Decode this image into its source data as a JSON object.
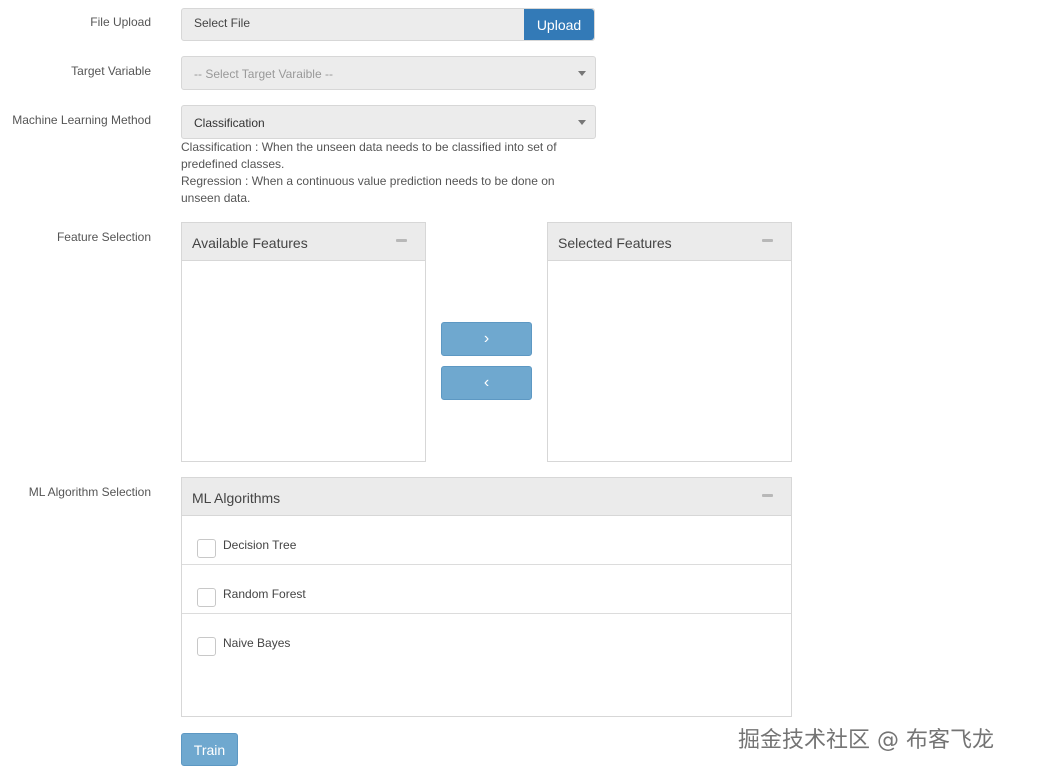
{
  "form": {
    "file_upload_label": "File Upload",
    "file_placeholder": "Select File",
    "upload_button": "Upload",
    "target_variable_label": "Target Variable",
    "target_variable_value": "-- Select Target Varaible --",
    "ml_method_label": "Machine Learning Method",
    "ml_method_value": "Classification",
    "help_classification": "Classification : When the unseen data needs to be classified into set of predefined classes.",
    "help_regression": "Regression : When a continuous value prediction needs to be done on unseen data.",
    "feature_selection_label": "Feature Selection",
    "available_features_title": "Available Features",
    "selected_features_title": "Selected Features",
    "move_right_button": "›",
    "move_left_button": "‹",
    "ml_algorithm_selection_label": "ML Algorithm Selection",
    "ml_algorithms_title": "ML Algorithms",
    "algorithms": [
      {
        "label": "Decision Tree",
        "checked": false
      },
      {
        "label": "Random Forest",
        "checked": false
      },
      {
        "label": "Naive Bayes",
        "checked": false
      }
    ],
    "train_button": "Train"
  },
  "watermark": "掘金技术社区 @ 布客飞龙",
  "colors": {
    "primary": "#337ab7",
    "primary_light": "#6fa8cf",
    "field_bg": "#ececec"
  }
}
